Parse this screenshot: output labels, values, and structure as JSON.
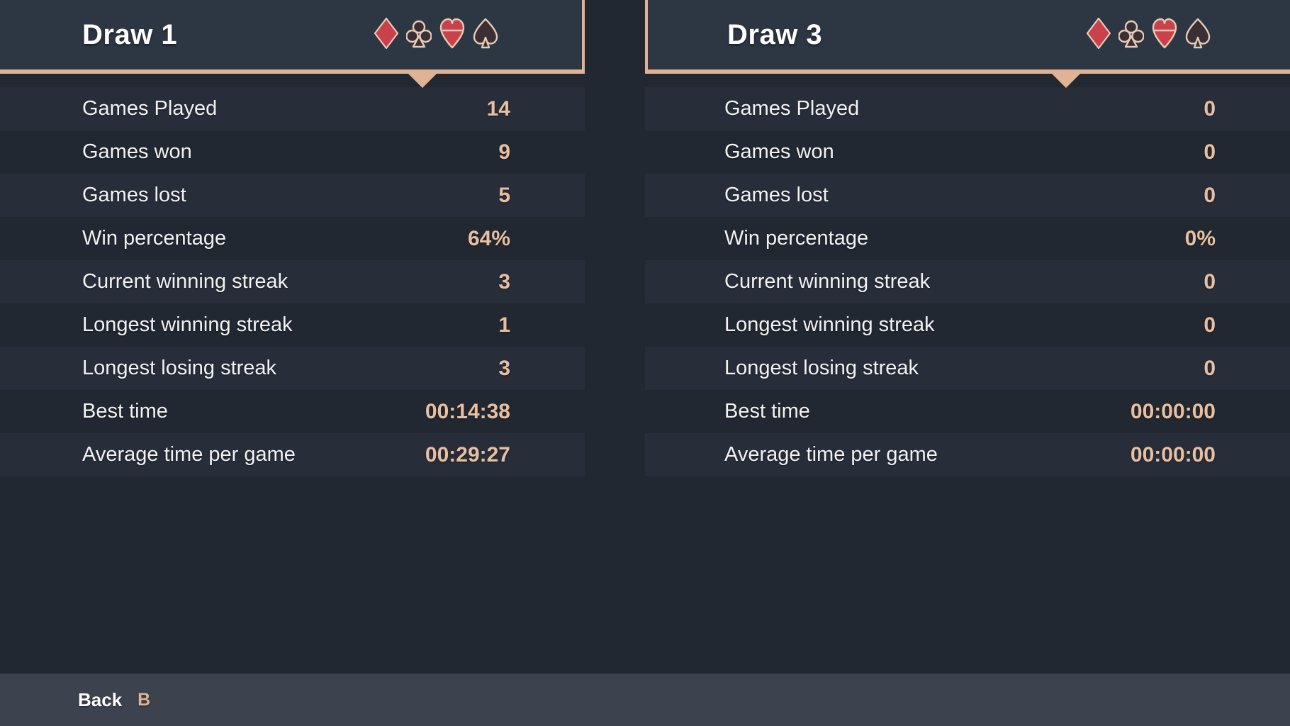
{
  "theme": {
    "background": "#212832",
    "row_alt_background": "#272e3a",
    "tab_background": "#2d3744",
    "accent": "#e0b394",
    "value_color": "#e8bfa0",
    "label_color": "#f2f2f2",
    "bottom_bar_background": "#3d434e",
    "suit_red": "#c8414b",
    "suit_dark": "#3a2f35"
  },
  "suits": [
    {
      "name": "diamond-suit-icon",
      "label": "Diamonds"
    },
    {
      "name": "club-suit-icon",
      "label": "Clubs"
    },
    {
      "name": "heart-suit-icon",
      "label": "Hearts"
    },
    {
      "name": "spade-suit-icon",
      "label": "Spades"
    }
  ],
  "columns": [
    {
      "tab_title": "Draw 1",
      "active": true,
      "stats": [
        {
          "label": "Games Played",
          "value": "14"
        },
        {
          "label": "Games won",
          "value": "9"
        },
        {
          "label": "Games lost",
          "value": "5"
        },
        {
          "label": "Win percentage",
          "value": "64%"
        },
        {
          "label": "Current winning streak",
          "value": "3"
        },
        {
          "label": "Longest winning streak",
          "value": "1"
        },
        {
          "label": "Longest losing streak",
          "value": "3"
        },
        {
          "label": "Best time",
          "value": "00:14:38"
        },
        {
          "label": "Average time per game",
          "value": "00:29:27"
        }
      ]
    },
    {
      "tab_title": "Draw 3",
      "active": true,
      "stats": [
        {
          "label": "Games Played",
          "value": "0"
        },
        {
          "label": "Games won",
          "value": "0"
        },
        {
          "label": "Games lost",
          "value": "0"
        },
        {
          "label": "Win percentage",
          "value": "0%"
        },
        {
          "label": "Current winning streak",
          "value": "0"
        },
        {
          "label": "Longest winning streak",
          "value": "0"
        },
        {
          "label": "Longest losing streak",
          "value": "0"
        },
        {
          "label": "Best time",
          "value": "00:00:00"
        },
        {
          "label": "Average time per game",
          "value": "00:00:00"
        }
      ]
    }
  ],
  "bottom_bar": {
    "back_label": "Back",
    "back_key": "B"
  }
}
